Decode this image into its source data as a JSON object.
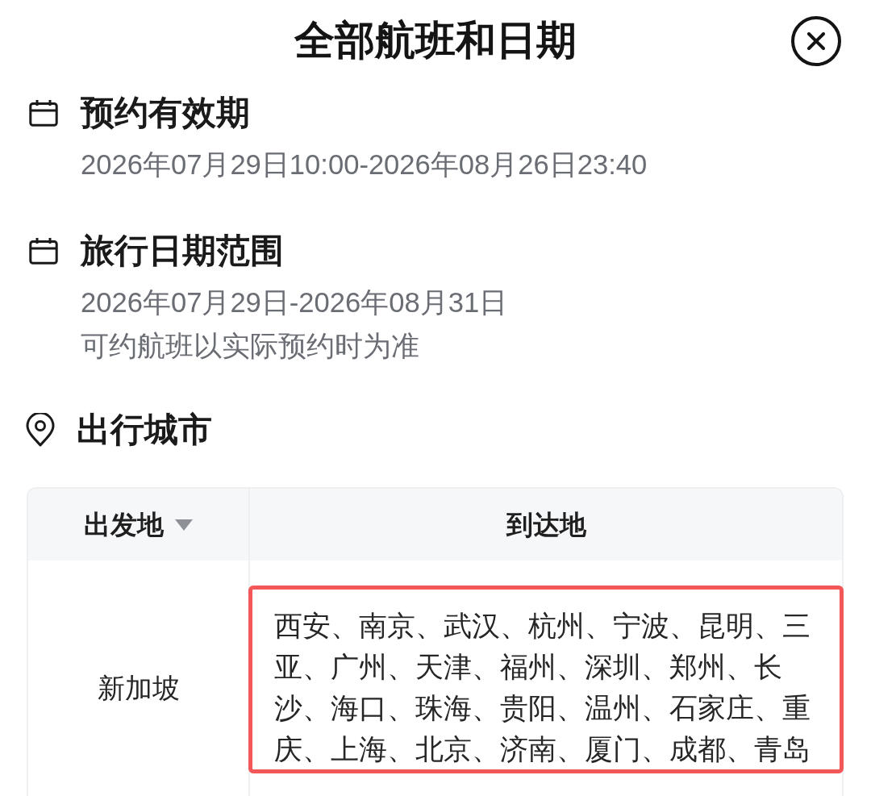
{
  "dialog": {
    "title": "全部航班和日期"
  },
  "sections": [
    {
      "kind": "calendar",
      "heading": "预约有效期",
      "lines": [
        "2026年07月29日10:00-2026年08月26日23:40"
      ]
    },
    {
      "kind": "calendar",
      "heading": "旅行日期范围",
      "lines": [
        "2026年07月29日-2026年08月31日",
        "可约航班以实际预约时为准"
      ]
    },
    {
      "kind": "location",
      "heading": "出行城市"
    }
  ],
  "table": {
    "columns": [
      {
        "label": "出发地",
        "dropdown": true
      },
      {
        "label": "到达地",
        "dropdown": false
      }
    ],
    "rows": [
      {
        "departure": "新加坡",
        "arrival": "西安、南京、武汉、杭州、宁波、昆明、三亚、广州、天津、福州、深圳、郑州、长沙、海口、珠海、贵阳、温州、石家庄、重庆、上海、北京、济南、厦门、成都、青岛",
        "highlighted": true
      }
    ]
  }
}
